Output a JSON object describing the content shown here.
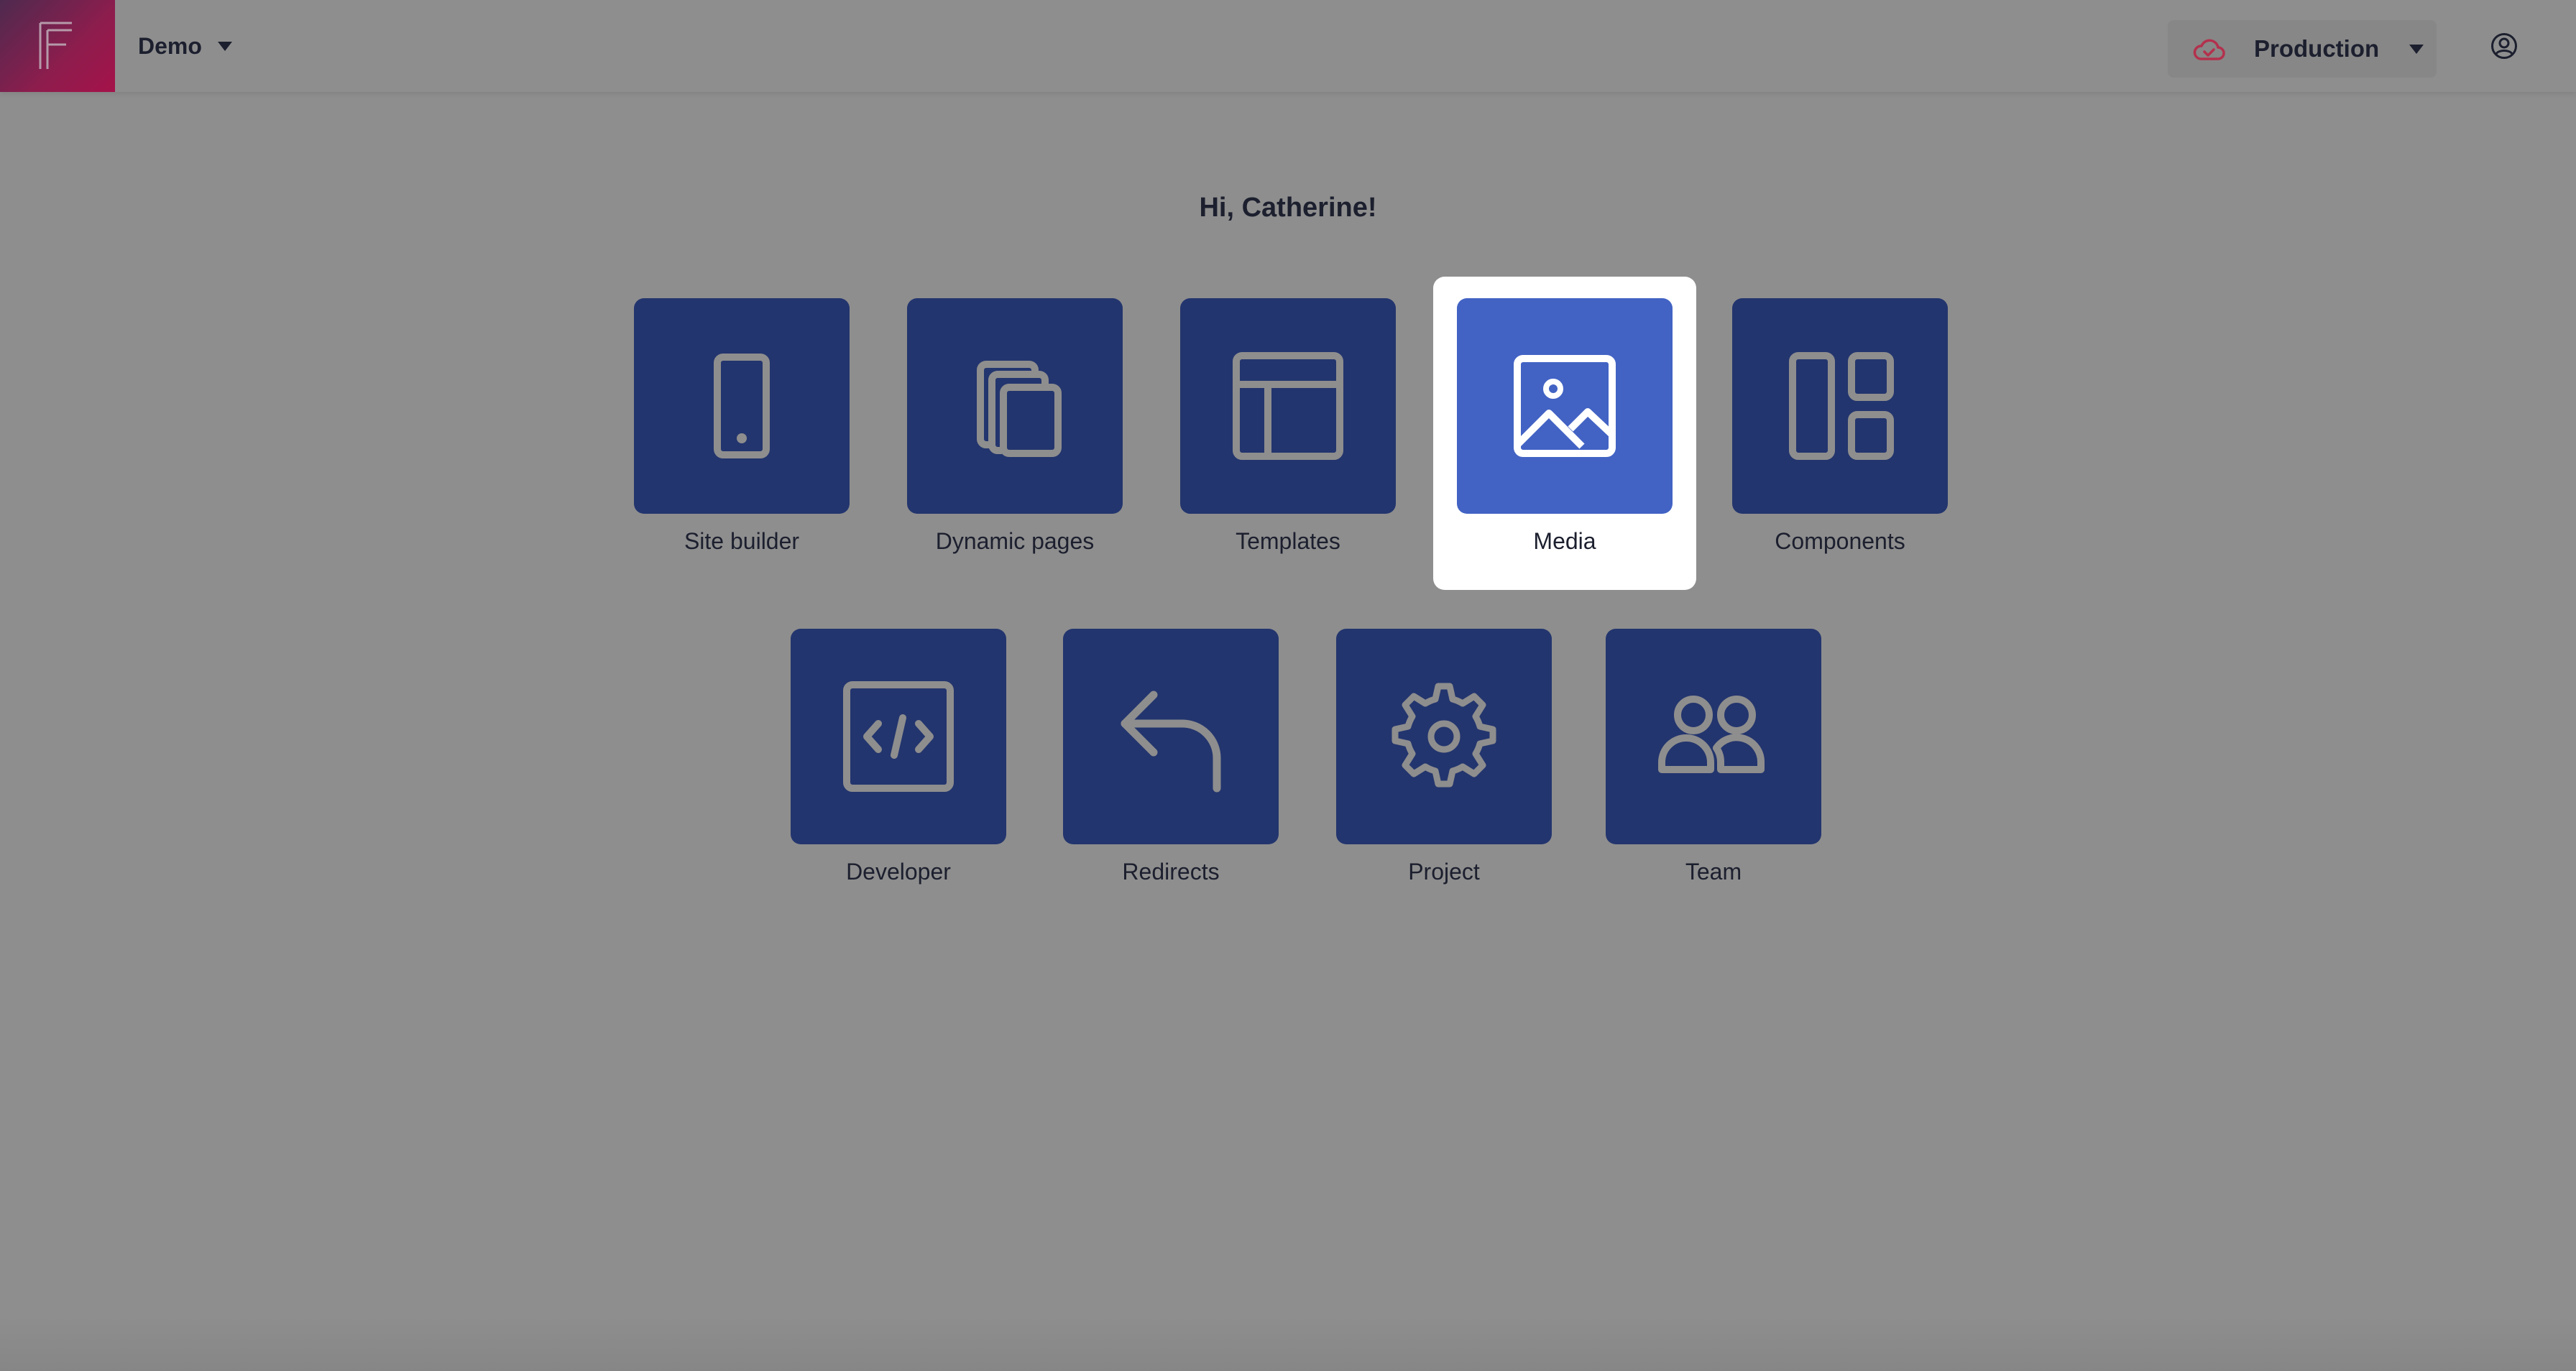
{
  "header": {
    "project_name": "Demo",
    "environment": {
      "label": "Production",
      "icon": "cloud-icon",
      "icon_color": "#b3314d"
    },
    "account_icon": "user-circle-icon"
  },
  "greeting": "Hi, Catherine!",
  "tiles": [
    {
      "label": "Site builder",
      "icon": "tablet-icon",
      "active": false
    },
    {
      "label": "Dynamic pages",
      "icon": "stacked-pages-icon",
      "active": false
    },
    {
      "label": "Templates",
      "icon": "layout-template-icon",
      "active": false
    },
    {
      "label": "Media",
      "icon": "image-icon",
      "active": true
    },
    {
      "label": "Components",
      "icon": "components-icon",
      "active": false
    },
    {
      "label": "Developer",
      "icon": "code-icon",
      "active": false
    },
    {
      "label": "Redirects",
      "icon": "redirect-arrow-icon",
      "active": false
    },
    {
      "label": "Project",
      "icon": "gear-icon",
      "active": false
    },
    {
      "label": "Team",
      "icon": "team-icon",
      "active": false
    }
  ],
  "colors": {
    "tile": "#23356e",
    "tile_active": "#4263c4",
    "icon": "#8e8e8e",
    "icon_active": "#ffffff",
    "brand_gradient_start": "#4e2a4f",
    "brand_gradient_end": "#a5124a"
  }
}
